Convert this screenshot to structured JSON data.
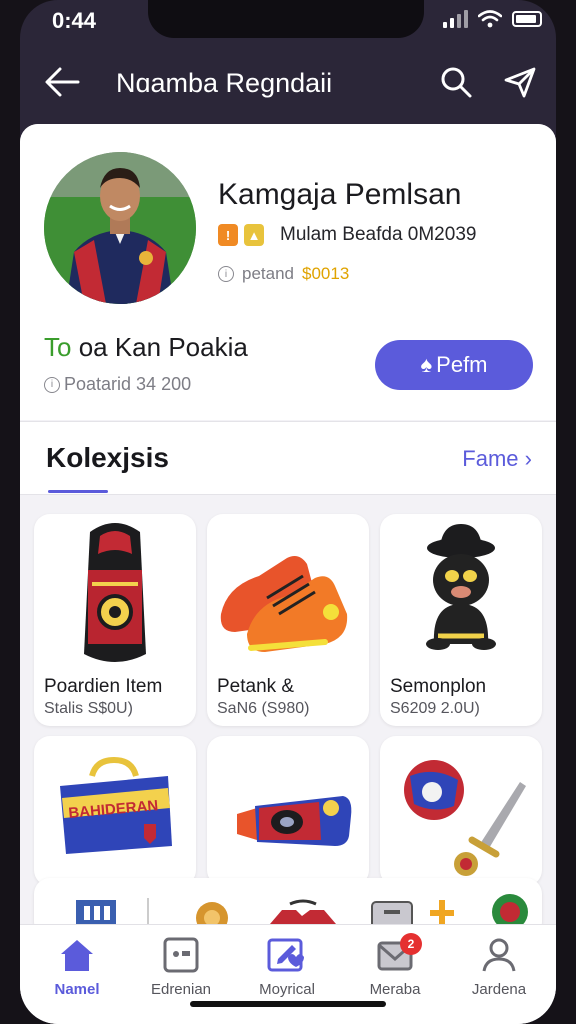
{
  "status_bar": {
    "time": "0:44"
  },
  "app_bar": {
    "title": "Nɑamba Regndaii",
    "back_icon": "arrow-left-icon",
    "search_icon": "search-icon",
    "share_icon": "send-icon"
  },
  "profile": {
    "name": "Kamgaja Pemlsan",
    "meta": "Mulam Beafda 0M2039",
    "points_label": "petand",
    "points_value": "$0013",
    "fav_prefix": "To",
    "fav_rest": " oa Kan Poakia",
    "sub_line": "Poatarid 34 200",
    "follow_label": "Pefm"
  },
  "collection": {
    "title": "Kolexjsis",
    "see_more": "Fame",
    "items": [
      {
        "name": "Poardien Item",
        "price": "Stalis S$0U)"
      },
      {
        "name": "Petank &",
        "price": "SaN6 (S980)"
      },
      {
        "name": "Semonplon",
        "price": "S6209 2.0U)"
      }
    ]
  },
  "bottom_nav": [
    {
      "label": "Namel",
      "icon": "home-icon",
      "active": true
    },
    {
      "label": "Edrenian",
      "icon": "gallery-icon",
      "active": false
    },
    {
      "label": "Moyrical",
      "icon": "edit-heart-icon",
      "active": false
    },
    {
      "label": "Meraba",
      "icon": "mail-icon",
      "active": false,
      "badge": "2"
    },
    {
      "label": "Jardena",
      "icon": "profile-icon",
      "active": false
    }
  ],
  "colors": {
    "accent": "#5b5bdb",
    "header": "#2b2638",
    "fav_green": "#3a9d2c",
    "points_gold": "#e0a300",
    "badge_red": "#e53030"
  }
}
